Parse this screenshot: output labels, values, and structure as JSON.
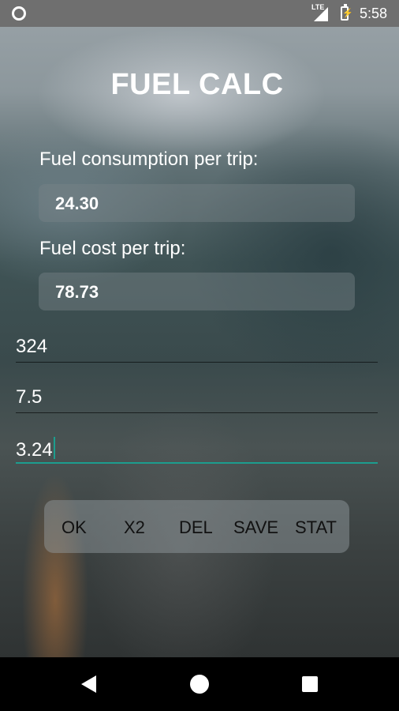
{
  "status_bar": {
    "network": "LTE",
    "time": "5:58",
    "icons": [
      "notification-circle-icon",
      "signal-icon",
      "battery-charging-icon"
    ]
  },
  "app": {
    "title": "FUEL CALC"
  },
  "results": {
    "consumption_label": "Fuel consumption per trip:",
    "consumption_value": "24.30",
    "cost_label": "Fuel cost per trip:",
    "cost_value": "78.73"
  },
  "inputs": {
    "distance_value": "324",
    "rate_value": "7.5",
    "price_value": "3.24"
  },
  "buttons": {
    "ok": "OK",
    "x2": "X2",
    "del": "DEL",
    "save": "SAVE",
    "stat": "STAT"
  },
  "colors": {
    "accent": "#1c9d8e",
    "status_bar": "#6f6f6f"
  },
  "nav_bar": {
    "icons": [
      "back-icon",
      "home-icon",
      "recents-icon"
    ]
  }
}
